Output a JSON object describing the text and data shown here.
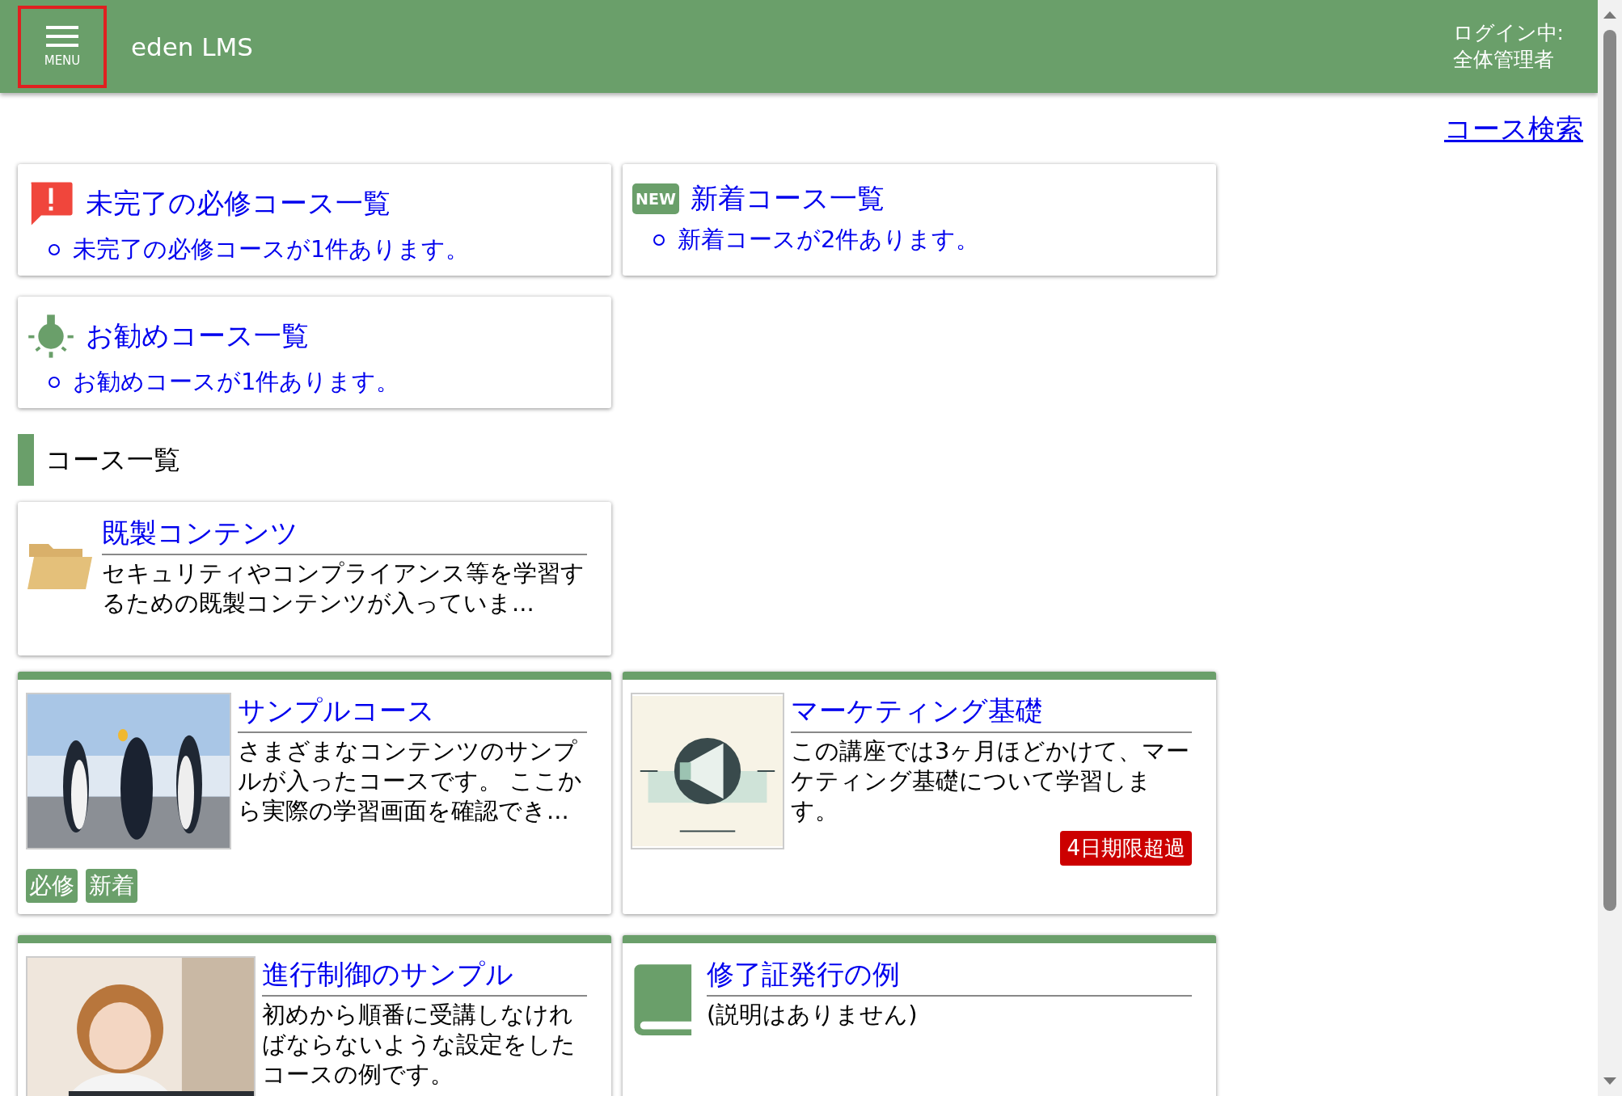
{
  "header": {
    "menu_label": "MENU",
    "title": "eden LMS",
    "login_lines": [
      "ログイン中:",
      "全体管理者"
    ]
  },
  "search_link": "コース検索",
  "notices": [
    {
      "kind": "alert",
      "title": "未完了の必修コース一覧",
      "items": [
        "未完了の必修コースが1件あります。"
      ]
    },
    {
      "kind": "new",
      "title": "新着コース一覧",
      "icon_text": "NEW",
      "items": [
        "新着コースが2件あります。"
      ]
    },
    {
      "kind": "recommend",
      "title": "お勧めコース一覧",
      "items": [
        "お勧めコースが1件あります。"
      ]
    }
  ],
  "section_title": "コース一覧",
  "courses": [
    {
      "kind": "folder",
      "title": "既製コンテンツ",
      "description": "セキュリティやコンプライアンス等を学習するための既製コンテンツが入っていま..."
    },
    {
      "title": "サンプルコース",
      "description": "さまざまなコンテンツのサンプルが入ったコースです。 ここから実際の学習画面を確認でき...",
      "tags": [
        "必修",
        "新着"
      ]
    },
    {
      "title": "マーケティング基礎",
      "description": "この講座では3ヶ月ほどかけて、マーケティング基礎について学習します。",
      "overdue": "4日期限超過"
    },
    {
      "title": "進行制御のサンプル",
      "description": "初めから順番に受講しなければならないような設定をしたコースの例です。"
    },
    {
      "kind": "book",
      "title": "修了証発行の例",
      "description": "(説明はありません)"
    }
  ]
}
